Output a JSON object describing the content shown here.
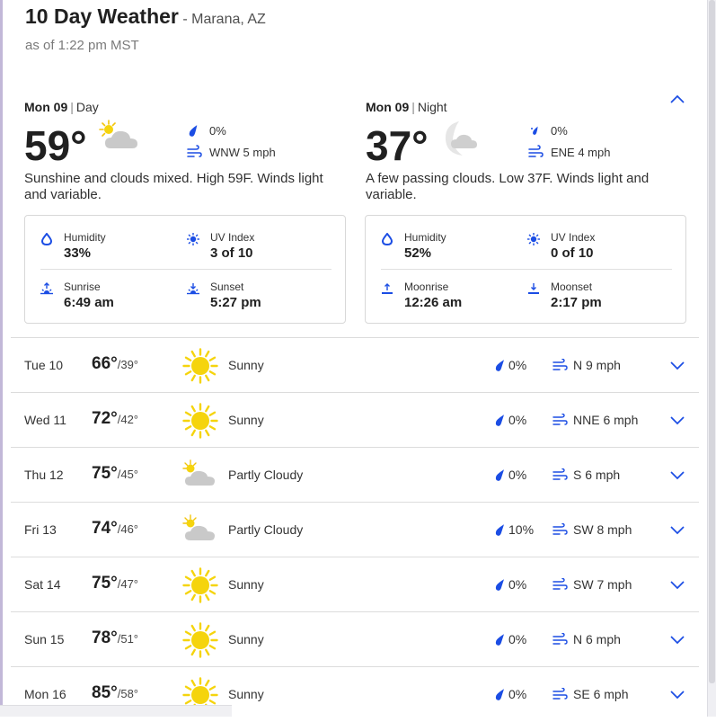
{
  "header": {
    "title": "10 Day Weather",
    "location": "- Marana, AZ",
    "as_of": "as of 1:22 pm MST"
  },
  "day_panel": {
    "date": "Mon 09",
    "period": "Day",
    "temp": "59°",
    "precip": "0%",
    "wind": "WNW 5 mph",
    "description": "Sunshine and clouds mixed. High 59F. Winds light and variable.",
    "icon": "partly-cloudy-day-icon",
    "details": {
      "humidity_label": "Humidity",
      "humidity": "33%",
      "uv_label": "UV Index",
      "uv": "3 of 10",
      "sunrise_label": "Sunrise",
      "sunrise": "6:49 am",
      "sunset_label": "Sunset",
      "sunset": "5:27 pm"
    }
  },
  "night_panel": {
    "date": "Mon 09",
    "period": "Night",
    "temp": "37°",
    "precip": "0%",
    "wind": "ENE 4 mph",
    "description": "A few passing clouds. Low 37F. Winds light and variable.",
    "icon": "partly-cloudy-night-icon",
    "details": {
      "humidity_label": "Humidity",
      "humidity": "52%",
      "uv_label": "UV Index",
      "uv": "0 of 10",
      "moonrise_label": "Moonrise",
      "moonrise": "12:26 am",
      "moonset_label": "Moonset",
      "moonset": "2:17 pm"
    }
  },
  "forecast": [
    {
      "day": "Tue 10",
      "hi": "66°",
      "lo": "/39°",
      "cond": "Sunny",
      "icon": "sunny",
      "precip": "0%",
      "wind": "N 9 mph"
    },
    {
      "day": "Wed 11",
      "hi": "72°",
      "lo": "/42°",
      "cond": "Sunny",
      "icon": "sunny",
      "precip": "0%",
      "wind": "NNE 6 mph"
    },
    {
      "day": "Thu 12",
      "hi": "75°",
      "lo": "/45°",
      "cond": "Partly Cloudy",
      "icon": "partly-cloudy",
      "precip": "0%",
      "wind": "S 6 mph"
    },
    {
      "day": "Fri 13",
      "hi": "74°",
      "lo": "/46°",
      "cond": "Partly Cloudy",
      "icon": "partly-cloudy",
      "precip": "10%",
      "wind": "SW 8 mph"
    },
    {
      "day": "Sat 14",
      "hi": "75°",
      "lo": "/47°",
      "cond": "Sunny",
      "icon": "sunny",
      "precip": "0%",
      "wind": "SW 7 mph"
    },
    {
      "day": "Sun 15",
      "hi": "78°",
      "lo": "/51°",
      "cond": "Sunny",
      "icon": "sunny",
      "precip": "0%",
      "wind": "N 6 mph"
    },
    {
      "day": "Mon 16",
      "hi": "85°",
      "lo": "/58°",
      "cond": "Sunny",
      "icon": "sunny",
      "precip": "0%",
      "wind": "SE 6 mph"
    }
  ],
  "colors": {
    "accent": "#1b4de4",
    "sun": "#f5d40d",
    "cloud": "#c9c9c9",
    "border": "#d8d8d8"
  }
}
